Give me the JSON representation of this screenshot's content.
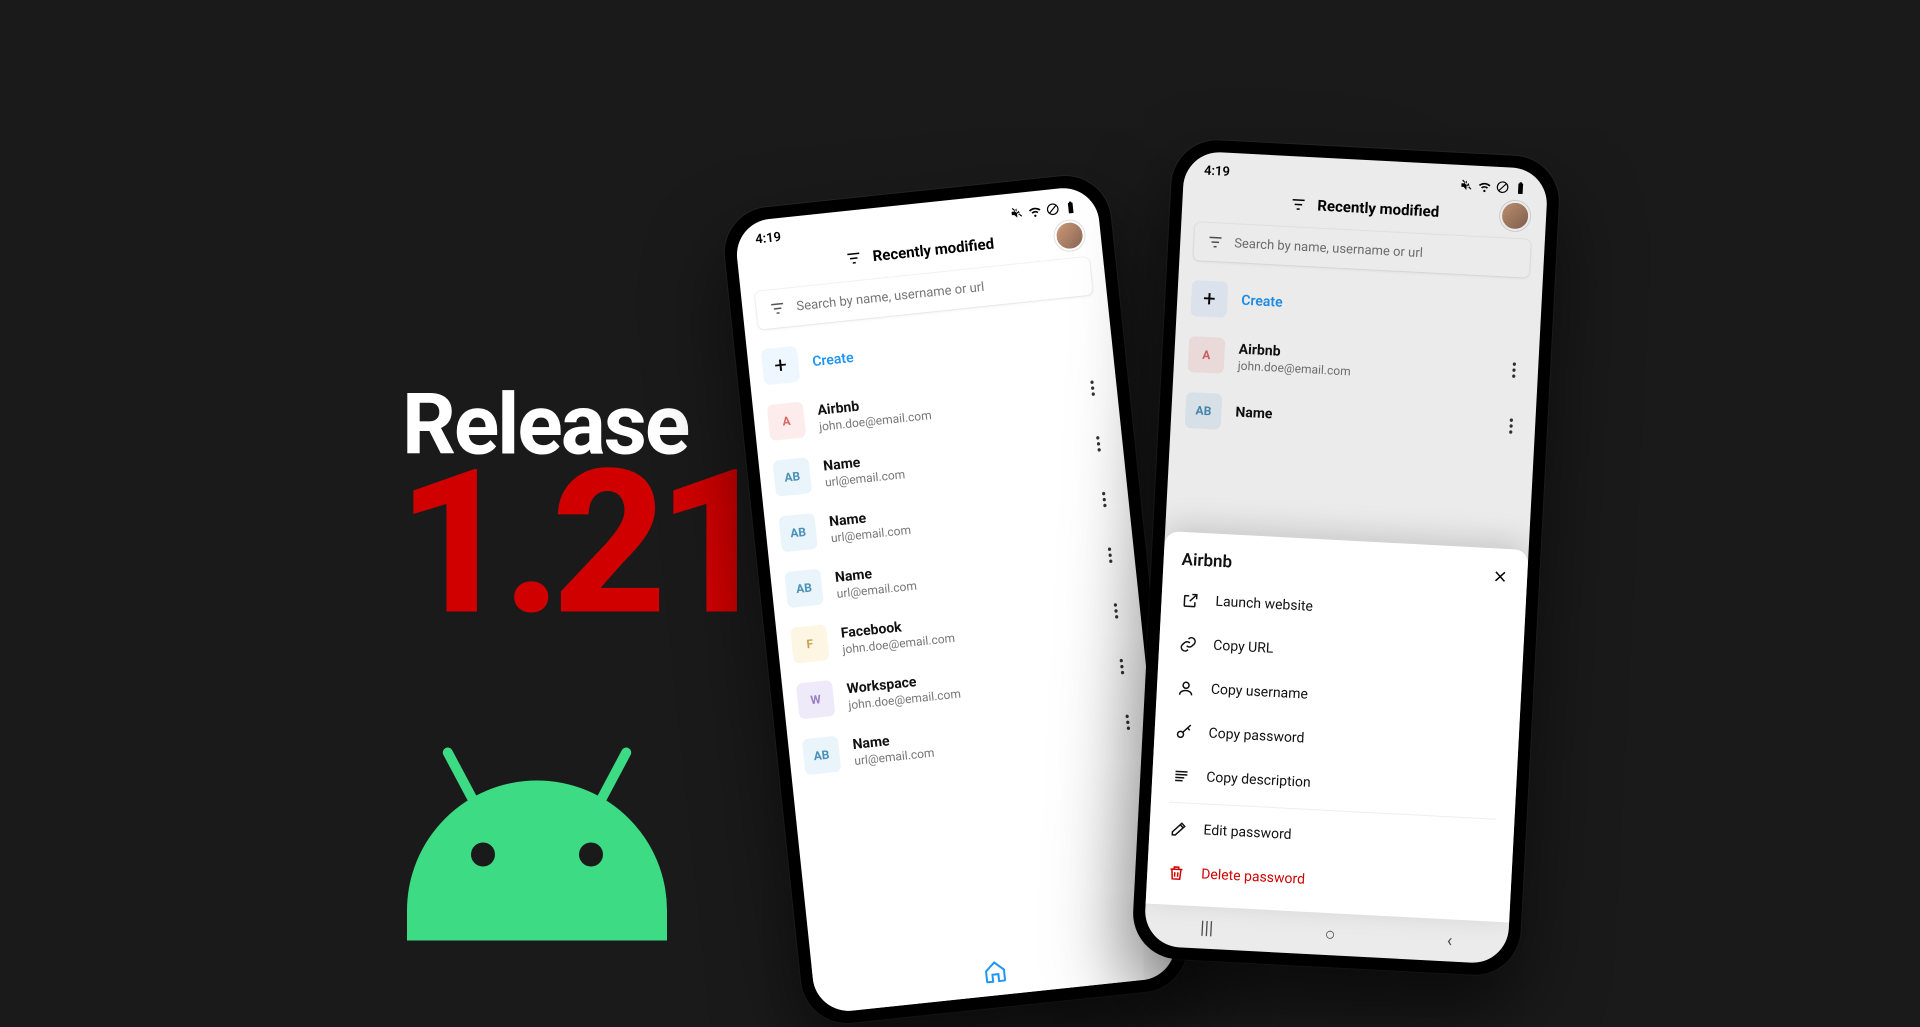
{
  "release": {
    "label": "Release",
    "version": "1.21"
  },
  "status": {
    "time": "4:19"
  },
  "header": {
    "title": "Recently modified"
  },
  "search": {
    "placeholder": "Search by name, username or url"
  },
  "create": {
    "label": "Create"
  },
  "entries": [
    {
      "badge": "A",
      "cls": "pink",
      "title": "Airbnb",
      "sub": "john.doe@email.com"
    },
    {
      "badge": "AB",
      "cls": "blue",
      "title": "Name",
      "sub": "url@email.com"
    },
    {
      "badge": "AB",
      "cls": "blue",
      "title": "Name",
      "sub": "url@email.com"
    },
    {
      "badge": "AB",
      "cls": "blue",
      "title": "Name",
      "sub": "url@email.com"
    },
    {
      "badge": "F",
      "cls": "yellow",
      "title": "Facebook",
      "sub": "john.doe@email.com"
    },
    {
      "badge": "W",
      "cls": "lav",
      "title": "Workspace",
      "sub": "john.doe@email.com"
    },
    {
      "badge": "AB",
      "cls": "blue",
      "title": "Name",
      "sub": "url@email.com"
    }
  ],
  "right_entries": [
    {
      "badge": "A",
      "cls": "pink",
      "title": "Airbnb",
      "sub": "john.doe@email.com"
    },
    {
      "badge": "AB",
      "cls": "blue",
      "title": "Name",
      "sub": ""
    }
  ],
  "sheet": {
    "title": "Airbnb",
    "launch": "Launch website",
    "copy_url": "Copy URL",
    "copy_user": "Copy username",
    "copy_pass": "Copy password",
    "copy_desc": "Copy description",
    "edit": "Edit password",
    "delete": "Delete password"
  }
}
